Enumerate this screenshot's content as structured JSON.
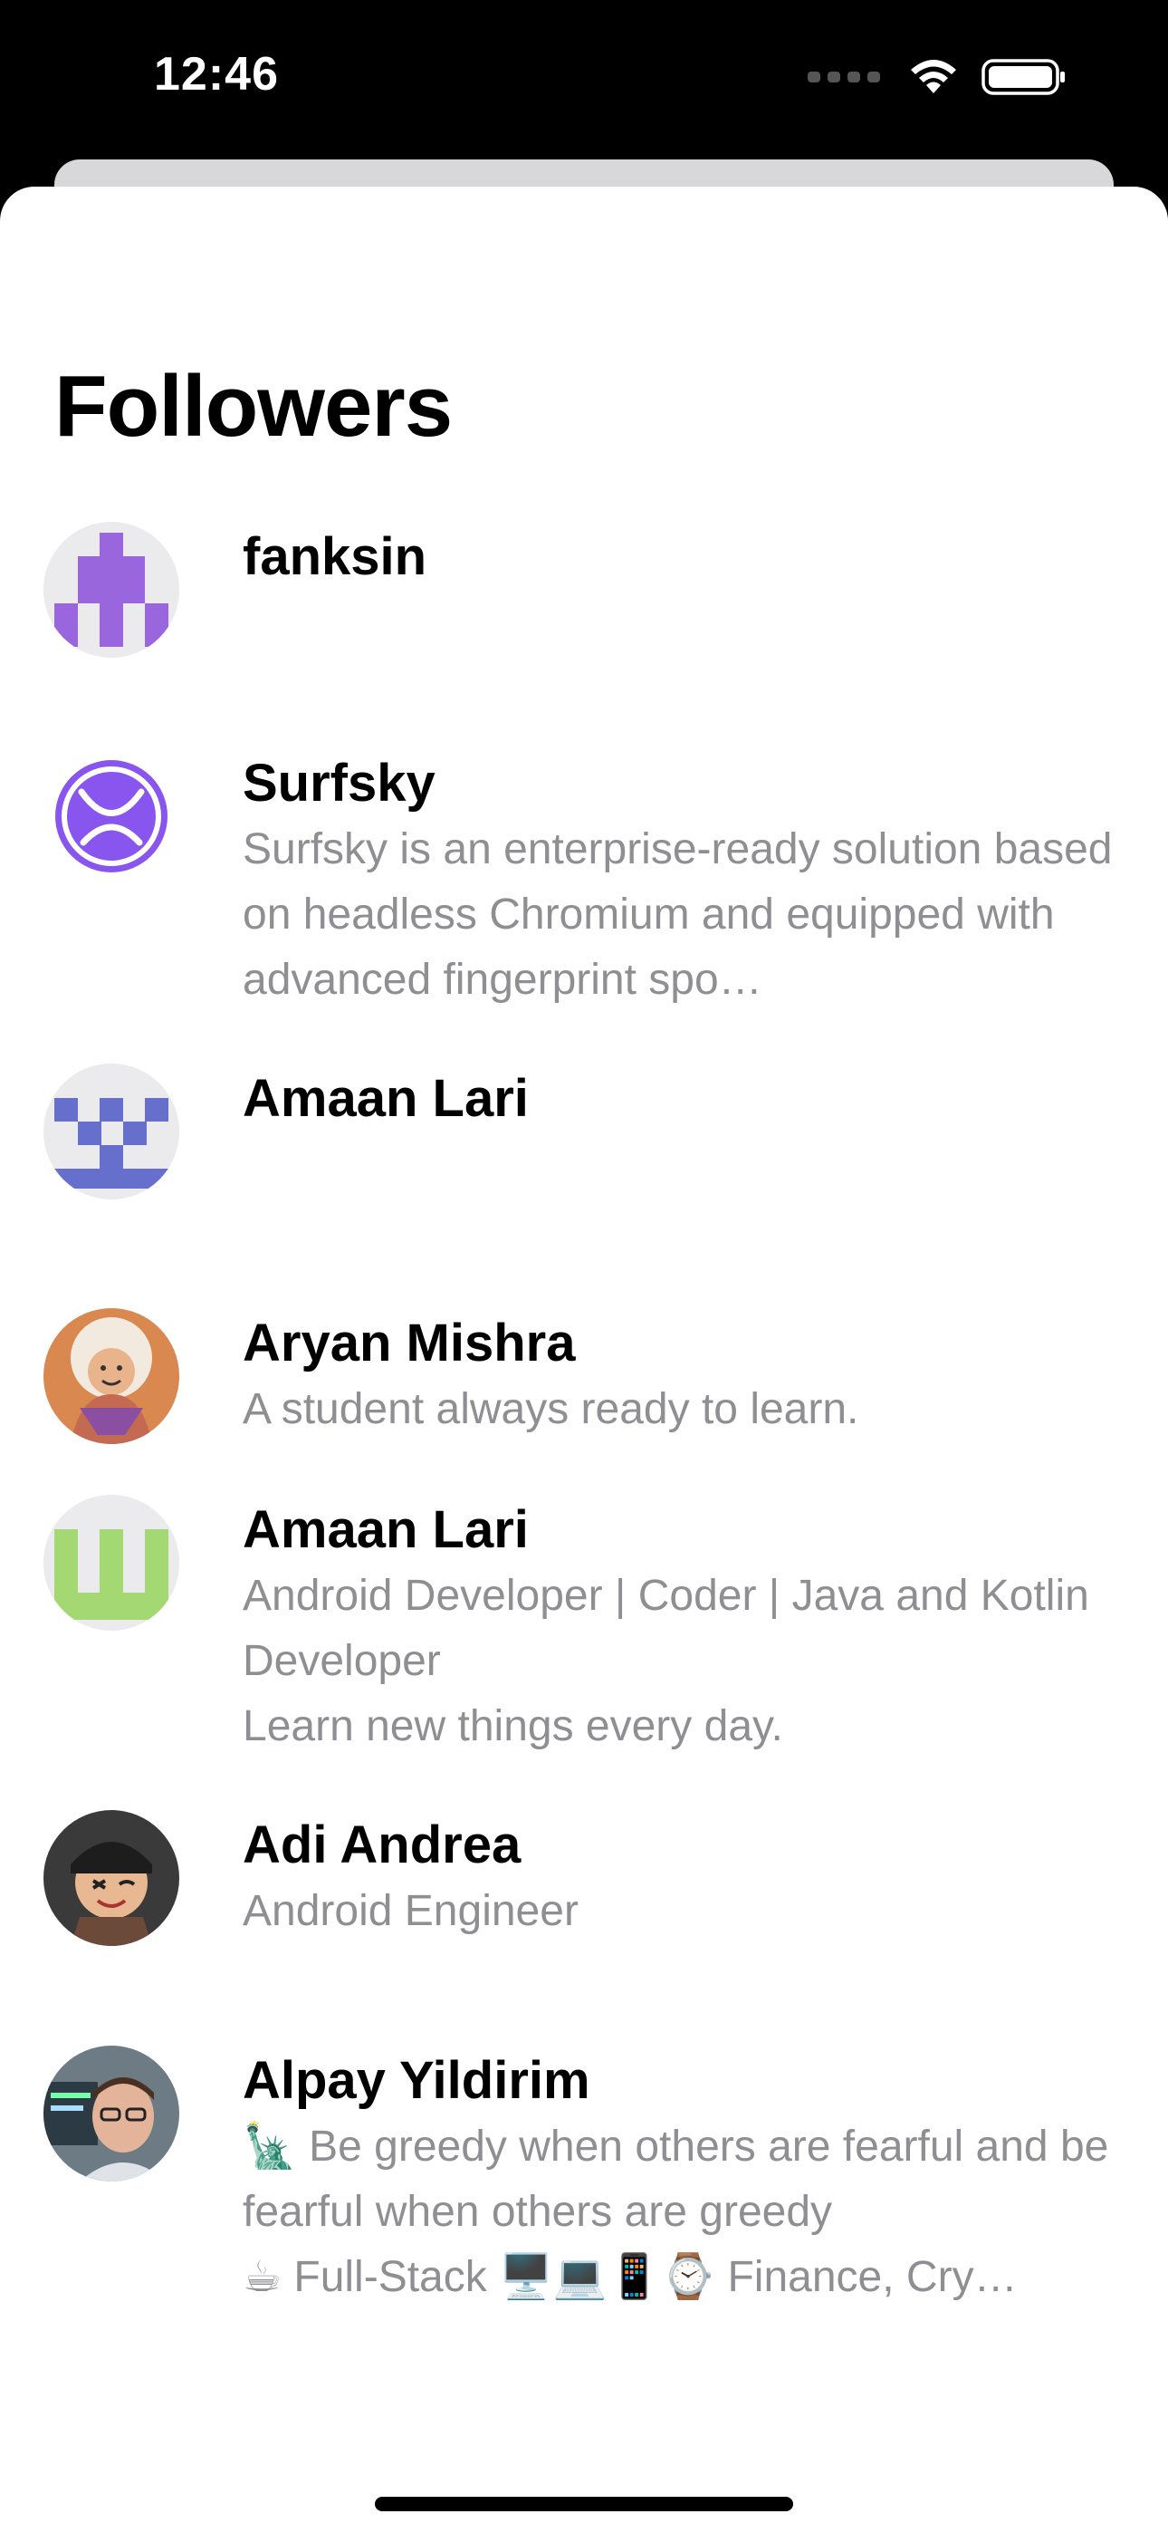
{
  "status_bar": {
    "time": "12:46"
  },
  "title": "Followers",
  "followers": [
    {
      "name": "fanksin",
      "bio": ""
    },
    {
      "name": "Surfsky",
      "bio": "Surfsky is an enterprise-ready solution based on headless Chromium and equipped with advanced fingerprint spo…"
    },
    {
      "name": "Amaan Lari",
      "bio": ""
    },
    {
      "name": "Aryan Mishra",
      "bio": "A student always ready to learn."
    },
    {
      "name": "Amaan Lari",
      "bio": "Android Developer | Coder | Java and Kotlin Developer\nLearn new things every day."
    },
    {
      "name": "Adi Andrea",
      "bio": "Android Engineer"
    },
    {
      "name": "Alpay Yildirim",
      "bio": "🗽 Be greedy when others are fearful and be fearful when others are greedy\n☕ Full-Stack 🖥️💻📱⌚ Finance, Cry…"
    }
  ],
  "colors": {
    "identicon_purple": "#9966dd",
    "surfsky_purple": "#8855ee",
    "identicon_blue": "#6670cc",
    "identicon_green": "#a3d872",
    "secondary_text": "#8e8e93"
  }
}
